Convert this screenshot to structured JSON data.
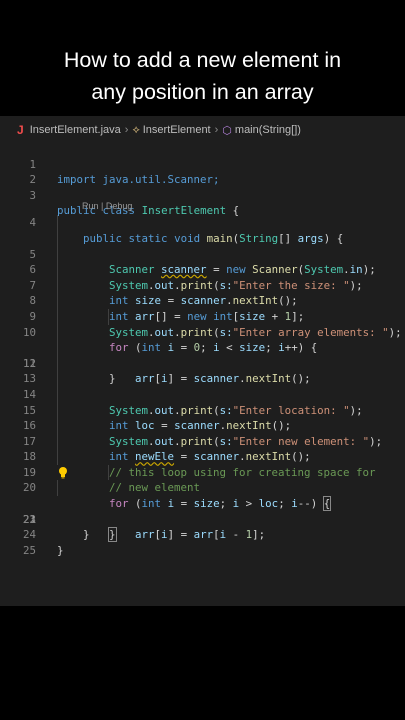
{
  "caption": {
    "line1": "How to add a new element in",
    "line2": "any position in an array"
  },
  "breadcrumb": {
    "file": "InsertElement.java",
    "class": "InsertElement",
    "method": "main(String[])"
  },
  "codelens": "Run | Debug",
  "lines": {
    "l1": {
      "num": "1",
      "p": [
        "import java.util.Scanner;"
      ]
    },
    "l2": {
      "num": "2"
    },
    "l3": {
      "num": "3",
      "p": [
        "public",
        "class",
        "InsertElement",
        " {"
      ]
    },
    "l4": {
      "num": "4",
      "p": [
        "public",
        "static",
        "void",
        "main",
        "(",
        "String",
        "[] ",
        "args",
        ") {"
      ]
    },
    "l5": {
      "num": "5",
      "p": [
        "Scanner",
        "scanner",
        " = ",
        "new",
        "Scanner",
        "(",
        "System",
        ".",
        "in",
        ");"
      ]
    },
    "l6": {
      "num": "6",
      "p": [
        "System",
        ".",
        "out",
        ".",
        "print",
        "(",
        "s:",
        "\"Enter the size: \"",
        ");"
      ]
    },
    "l7": {
      "num": "7",
      "p": [
        "int",
        "size",
        " = ",
        "scanner",
        ".",
        "nextInt",
        "();"
      ]
    },
    "l8": {
      "num": "8",
      "p": [
        "int",
        "arr",
        "[] = ",
        "new",
        "int",
        "[",
        "size",
        " + ",
        "1",
        "];"
      ]
    },
    "l9": {
      "num": "9",
      "p": [
        "System",
        ".",
        "out",
        ".",
        "print",
        "(",
        "s:",
        "\"Enter array elements: \"",
        ");"
      ]
    },
    "l10": {
      "num": "10",
      "p": [
        "for",
        " (",
        "int",
        "i",
        " = ",
        "0",
        "; ",
        "i",
        " < ",
        "size",
        "; ",
        "i",
        "++) {"
      ]
    },
    "l11": {
      "num": "11",
      "p": [
        "arr",
        "[",
        "i",
        "] = ",
        "scanner",
        ".",
        "nextInt",
        "();"
      ]
    },
    "l12": {
      "num": "12",
      "p": [
        "}"
      ]
    },
    "l13": {
      "num": "13"
    },
    "l14": {
      "num": "14",
      "p": [
        "System",
        ".",
        "out",
        ".",
        "print",
        "(",
        "s:",
        "\"Enter location: \"",
        ");"
      ]
    },
    "l15": {
      "num": "15",
      "p": [
        "int",
        "loc",
        " = ",
        "scanner",
        ".",
        "nextInt",
        "();"
      ]
    },
    "l16": {
      "num": "16",
      "p": [
        "System",
        ".",
        "out",
        ".",
        "print",
        "(",
        "s:",
        "\"Enter new element: \"",
        ");"
      ]
    },
    "l17": {
      "num": "17",
      "p": [
        "int",
        "newEle",
        " = ",
        "scanner",
        ".",
        "nextInt",
        "();"
      ]
    },
    "l18": {
      "num": "18",
      "p": [
        "// this loop using for creating space for"
      ]
    },
    "l19": {
      "num": "19",
      "p": [
        "// new element"
      ]
    },
    "l20": {
      "num": "20",
      "p": [
        "for",
        " (",
        "int",
        "i",
        " = ",
        "size",
        "; ",
        "i",
        " > ",
        "loc",
        "; ",
        "i",
        "--) ",
        "{"
      ]
    },
    "l21": {
      "num": "21",
      "p": [
        "arr",
        "[",
        "i",
        "] = ",
        "arr",
        "[",
        "i",
        " - ",
        "1",
        "];"
      ]
    },
    "l22": {
      "num": "22",
      "p": [
        "}"
      ]
    },
    "l23": {
      "num": "23",
      "p": [
        "}"
      ]
    },
    "l24": {
      "num": "24",
      "p": [
        "}"
      ]
    },
    "l25": {
      "num": "25"
    }
  },
  "colors": {
    "editor_bg": "#1e1e1e",
    "keyword": "#569cd6",
    "type": "#4ec9b0",
    "string": "#ce9178",
    "comment": "#6a9955"
  }
}
